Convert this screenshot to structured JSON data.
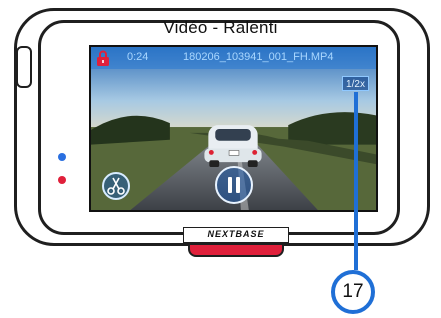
{
  "title": "Vidéo - Ralenti",
  "playback": {
    "time": "0:24",
    "filename": "180206_103941_001_FH.MP4",
    "speed": "1/2x",
    "locked": true,
    "state": "paused"
  },
  "brand": "NEXTBASE",
  "callout_number": "17",
  "colors": {
    "accent_blue": "#1f6fd6",
    "button_red": "#e0203b",
    "led_blue": "#2a6fe0",
    "led_red": "#e0203b"
  },
  "icons": [
    "lock-icon",
    "scissors-icon",
    "pause-icon"
  ]
}
